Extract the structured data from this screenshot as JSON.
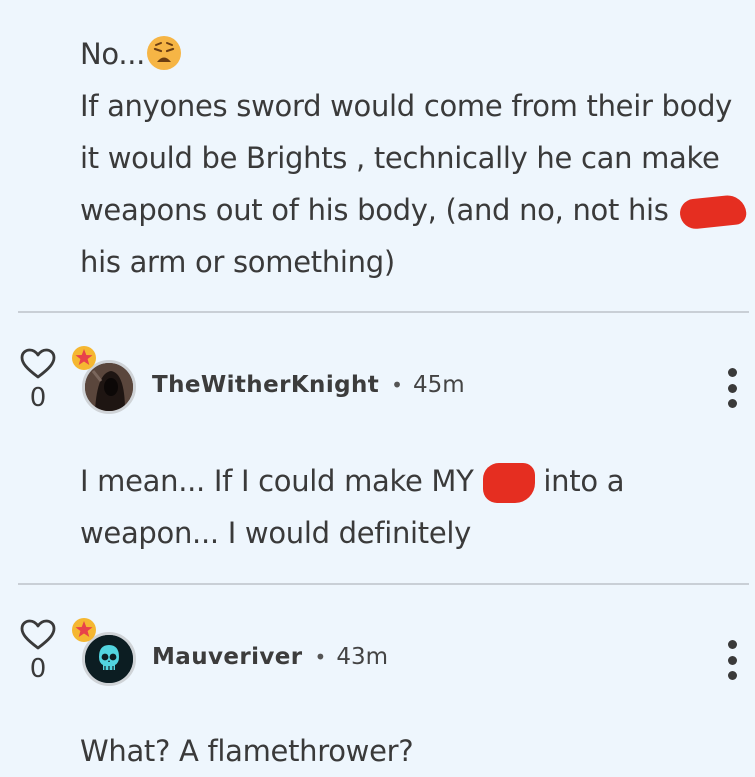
{
  "comments": [
    {
      "lines": [
        "No...",
        "If anyones sword would come from their body",
        "it would be Brights , technically he can make",
        "weapons out of his body, (and no, not his",
        "his arm or something)"
      ],
      "emoji_icon": "weary-face-emoji"
    },
    {
      "username": "TheWitherKnight",
      "time": "45m",
      "likes": "0",
      "avatar_icon": "hooded-figure-avatar",
      "lines": [
        "I mean... If I could make MY",
        "into a",
        "weapon... I would definitely"
      ]
    },
    {
      "username": "Mauveriver",
      "time": "43m",
      "likes": "0",
      "avatar_icon": "cyan-skull-avatar",
      "lines": [
        "What? A flamethrower?"
      ]
    }
  ],
  "separator": "•",
  "colors": {
    "background": "#eef6fd",
    "redaction": "#e52e21",
    "star_badge": "#f5b731",
    "star_inner": "#e8424a"
  }
}
